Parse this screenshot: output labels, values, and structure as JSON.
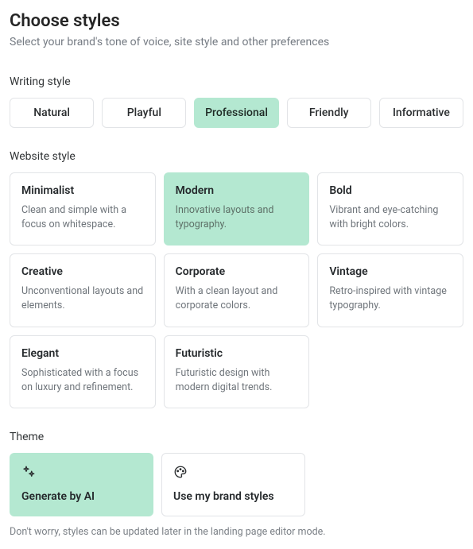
{
  "header": {
    "title": "Choose styles",
    "subtitle": "Select your brand's tone of voice, site style and other preferences"
  },
  "writing": {
    "label": "Writing style",
    "options": [
      {
        "label": "Natural",
        "selected": false
      },
      {
        "label": "Playful",
        "selected": false
      },
      {
        "label": "Professional",
        "selected": true
      },
      {
        "label": "Friendly",
        "selected": false
      },
      {
        "label": "Informative",
        "selected": false
      }
    ]
  },
  "website": {
    "label": "Website style",
    "options": [
      {
        "title": "Minimalist",
        "desc": "Clean and simple with a focus on whitespace.",
        "selected": false
      },
      {
        "title": "Modern",
        "desc": "Innovative layouts and typography.",
        "selected": true
      },
      {
        "title": "Bold",
        "desc": "Vibrant and eye-catching with bright colors.",
        "selected": false
      },
      {
        "title": "Creative",
        "desc": "Unconventional layouts and elements.",
        "selected": false
      },
      {
        "title": "Corporate",
        "desc": "With a clean layout and corporate colors.",
        "selected": false
      },
      {
        "title": "Vintage",
        "desc": "Retro-inspired with vintage typography.",
        "selected": false
      },
      {
        "title": "Elegant",
        "desc": "Sophisticated with a focus on luxury and refinement.",
        "selected": false
      },
      {
        "title": "Futuristic",
        "desc": "Futuristic design with modern digital trends.",
        "selected": false
      }
    ]
  },
  "theme": {
    "label": "Theme",
    "options": [
      {
        "title": "Generate by AI",
        "icon": "sparkle-icon",
        "selected": true
      },
      {
        "title": "Use my brand styles",
        "icon": "palette-icon",
        "selected": false
      }
    ]
  },
  "footer": {
    "note": "Don't worry, styles can be updated later in the landing page editor mode."
  }
}
